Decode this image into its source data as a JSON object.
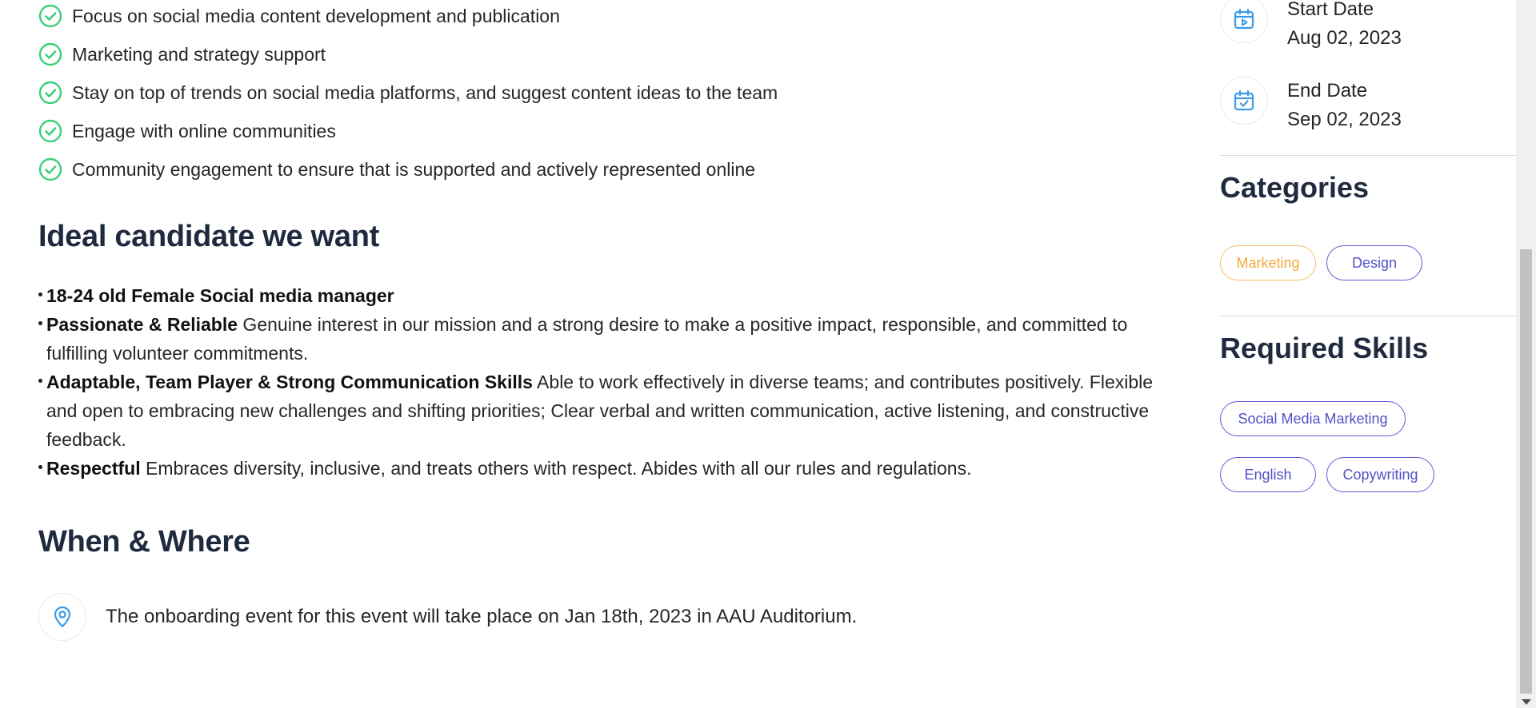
{
  "responsibilities": [
    "Focus on social media content development and publication",
    "Marketing and strategy support",
    "Stay on top of trends on social media platforms, and suggest content ideas to the team",
    "Engage with online communities",
    "Community engagement to ensure that is supported and actively represented online"
  ],
  "ideal": {
    "title": "Ideal candidate we want",
    "items": [
      {
        "bold": "18-24 old Female Social media manager",
        "text": ""
      },
      {
        "bold": "Passionate & Reliable",
        "text": " Genuine interest in our mission and a strong desire to make a positive impact, responsible, and committed to fulfilling volunteer commitments."
      },
      {
        "bold": "Adaptable, Team Player & Strong Communication Skills",
        "text": " Able to work effectively in diverse teams; and contributes positively. Flexible and open to embracing new challenges and shifting priorities; Clear verbal and written communication, active listening, and constructive feedback."
      },
      {
        "bold": "Respectful",
        "text": " Embraces diversity, inclusive, and treats others with respect. Abides with all our rules and regulations."
      }
    ]
  },
  "when_where": {
    "title": "When & Where",
    "text": "The onboarding event for this event will take place on Jan 18th, 2023 in AAU Auditorium."
  },
  "dates": {
    "start_label": "Start Date",
    "start_value": "Aug 02, 2023",
    "end_label": "End Date",
    "end_value": "Sep 02, 2023"
  },
  "categories": {
    "title": "Categories",
    "items": [
      "Marketing",
      "Design"
    ]
  },
  "skills": {
    "title": "Required Skills",
    "items": [
      "Social Media Marketing",
      "English",
      "Copywriting"
    ]
  },
  "icons": {
    "check": "check-circle-icon",
    "calendar_start": "calendar-play-icon",
    "calendar_end": "calendar-check-icon",
    "location": "map-pin-icon"
  },
  "colors": {
    "heading": "#1f2a3f",
    "check": "#3ccf7a",
    "icon_blue": "#3b9be6",
    "pill_border": "#5b5bd6",
    "pill_orange": "#f5c063"
  }
}
